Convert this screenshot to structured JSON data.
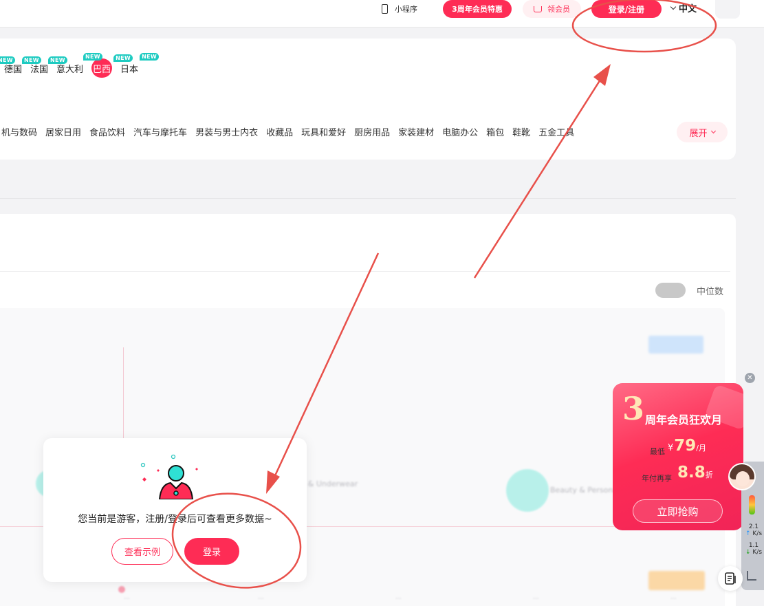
{
  "topbar": {
    "mini_program_label": "小程序",
    "promo_label": "3周年会员特惠",
    "member_label": "领会员",
    "login_label": "登录/注册",
    "language_label": "中文"
  },
  "countries": [
    {
      "label": "德国",
      "badge": "NEW"
    },
    {
      "label": "法国",
      "badge": "NEW"
    },
    {
      "label": "意大利",
      "badge": "NEW"
    },
    {
      "label": "巴西",
      "badge": "NEW",
      "active": true
    },
    {
      "label": "日本",
      "badge": "NEW"
    }
  ],
  "categories": [
    "机与数码",
    "居家日用",
    "食品饮料",
    "汽车与摩托车",
    "男装与男士内衣",
    "收藏品",
    "玩具和爱好",
    "厨房用品",
    "家装建材",
    "电脑办公",
    "箱包",
    "鞋靴",
    "五金工具"
  ],
  "expand_label": "展开",
  "chart": {
    "median_label": "中位数",
    "blur_labels": [
      "Lingerie & Underwear",
      "Beauty & Personal"
    ]
  },
  "guest_modal": {
    "message": "您当前是游客，注册/登录后可查看更多数据~",
    "example_button": "查看示例",
    "login_button": "登录"
  },
  "promo_card": {
    "big_number": "3",
    "title": "周年会员狂欢月",
    "price_label": "最低",
    "currency": "¥",
    "price": "79",
    "price_unit": "/月",
    "discount_label": "年付再享",
    "discount": "8.8",
    "discount_unit": "折",
    "cta": "立即抢购"
  },
  "side_widget": {
    "upload_speed": "2.1",
    "download_speed": "1.1",
    "speed_unit": "K/s"
  },
  "colors": {
    "brand": "#fe2c55",
    "teal_badge": "#1ecbc1",
    "annotation": "#e8504a"
  }
}
